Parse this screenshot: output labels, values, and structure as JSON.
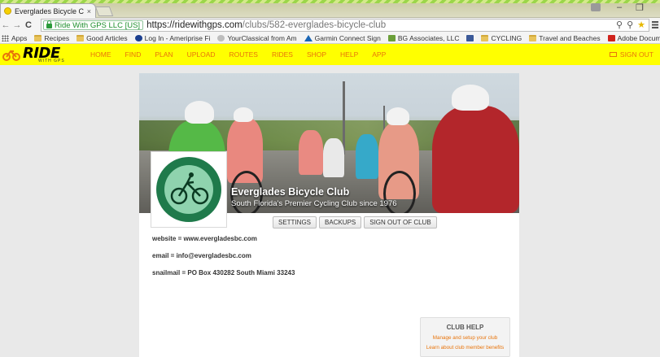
{
  "browser": {
    "tab_title": "Everglades Bicycle Club -",
    "tab_close": "×",
    "window_minimize": "–",
    "window_maximize": "❐",
    "back": "←",
    "forward": "→",
    "reload": "C",
    "security_label": "Ride With GPS LLC [US]",
    "url_host": "https://ridewithgps.com",
    "url_path": "/clubs/582-everglades-bicycle-club",
    "omnibox_icons": [
      "search-icon",
      "key-icon",
      "star-icon"
    ],
    "bookmarks": [
      {
        "label": "Apps",
        "icon": "apps-icon"
      },
      {
        "label": "Recipes",
        "icon": "folder-icon"
      },
      {
        "label": "Good Articles",
        "icon": "folder-icon"
      },
      {
        "label": "Log In - Ameriprise Fi",
        "icon": "clock-icon"
      },
      {
        "label": "YourClassical from Am",
        "icon": "circle-icon"
      },
      {
        "label": "Garmin Connect Sign",
        "icon": "triangle-icon"
      },
      {
        "label": "BG Associates, LLC",
        "icon": "bg-icon"
      },
      {
        "label": "",
        "icon": "facebook-icon"
      },
      {
        "label": "CYCLING",
        "icon": "folder-icon"
      },
      {
        "label": "Travel and Beaches",
        "icon": "folder-icon"
      },
      {
        "label": "Adobe Document Clo",
        "icon": "pdf-icon"
      }
    ]
  },
  "site": {
    "logo_word": "RIDE",
    "logo_sub": "WITH GPS",
    "nav": [
      "HOME",
      "FIND",
      "PLAN",
      "UPLOAD",
      "ROUTES",
      "RIDES",
      "SHOP",
      "HELP",
      "APP"
    ],
    "signout": "SIGN OUT",
    "brand_color": "#ffff00",
    "link_color": "#e8740b"
  },
  "club": {
    "name": "Everglades Bicycle Club",
    "tagline": "South Florida's Premier Cycling Club since 1976",
    "logo_text_top": "EVERGLADES BICYCLE CLUB",
    "logo_text_bottom": "MIAMI FLORIDA",
    "buttons": [
      "SETTINGS",
      "BACKUPS",
      "SIGN OUT OF CLUB"
    ],
    "website": "website = www.evergladesbc.com",
    "email": "email = info@evergladesbc.com",
    "snailmail": "snailmail = PO Box 430282 South Miami 33243"
  },
  "help": {
    "title": "CLUB HELP",
    "links": [
      "Manage and setup your club",
      "Learn about club member benefits"
    ]
  }
}
